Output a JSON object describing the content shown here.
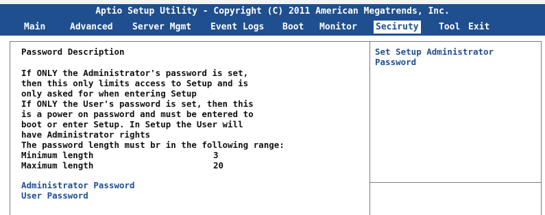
{
  "title": "Aptio Setup Utility - Copyright (C) 2011 American Megatrends, Inc.",
  "menu": {
    "items": [
      "Main",
      "Advanced",
      "Server Mgmt",
      "Event Logs",
      "Boot",
      "Monitor",
      "Seciruty",
      "Tool",
      "Exit"
    ],
    "selected": "Seciruty"
  },
  "description": {
    "heading": "Password Description",
    "lines": [
      "If ONLY the Administrator's password is set,",
      "then this only limits access to Setup and is",
      "only asked for when entering Setup",
      "If ONLY the User's password is set, then this",
      "is a power on password and must be entered to",
      "boot or enter Setup. In Setup the User will",
      "have Administrator rights",
      "The password length must br in the following range:"
    ],
    "min_label": "Minimum length",
    "min_value": "3",
    "max_label": "Maximum length",
    "max_value": "20"
  },
  "options": {
    "admin_password": "Administrator Password",
    "user_password": "User Password"
  },
  "help": {
    "line1": "Set Setup Administrator",
    "line2": "Password"
  },
  "colors": {
    "bar_blue": "#1f4f8f",
    "text_dark": "#111111",
    "border_gray": "#7a7a7a"
  }
}
